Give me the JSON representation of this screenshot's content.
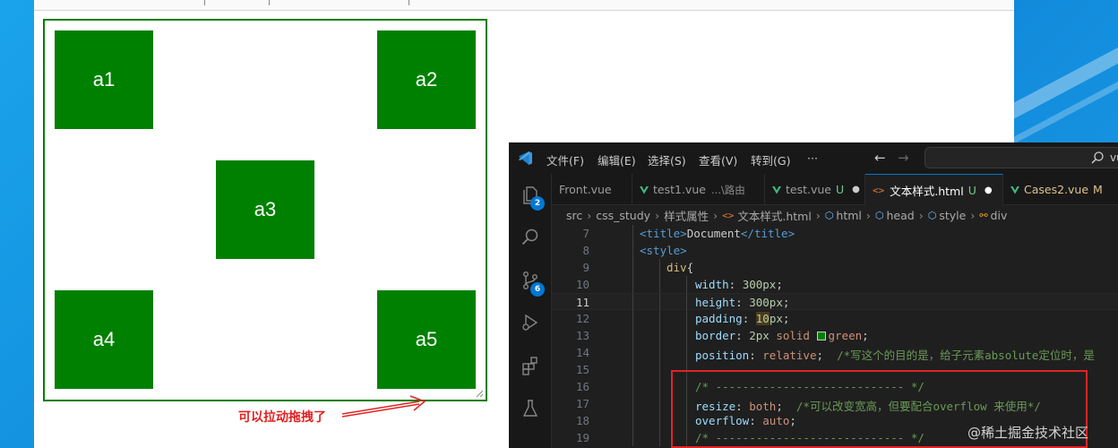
{
  "demo": {
    "boxes": [
      "a1",
      "a2",
      "a3",
      "a4",
      "a5"
    ],
    "annotation": "可以拉动拖拽了",
    "border_color": "#008000"
  },
  "vscode": {
    "menu": [
      "文件(F)",
      "编辑(E)",
      "选择(S)",
      "查看(V)",
      "转到(G)",
      "···"
    ],
    "search_text": "vu",
    "activity_badges": {
      "explorer": "2",
      "source_control": "6"
    },
    "tabs": [
      {
        "label": "Front.vue",
        "status": "",
        "desc": ""
      },
      {
        "label": "test1.vue",
        "status": "",
        "desc": "...\\路由"
      },
      {
        "label": "test.vue",
        "status": "U",
        "desc": ""
      },
      {
        "label": "文本样式.html",
        "status": "U",
        "desc": ""
      },
      {
        "label": "Cases2.vue",
        "status": "M",
        "desc": ""
      }
    ],
    "breadcrumb": [
      "src",
      "css_study",
      "样式属性",
      "文本样式.html",
      "html",
      "head",
      "style",
      "div"
    ],
    "lines": [
      "7",
      "8",
      "9",
      "10",
      "11",
      "12",
      "13",
      "14",
      "15",
      "16",
      "17",
      "18",
      "19"
    ],
    "code": {
      "l7_open": "<title>",
      "l7_text": "Document",
      "l7_close": "</title>",
      "l8": "<style>",
      "l9_sel": "div",
      "l9_brace": "{",
      "l10_prop": "width",
      "l10_val": "300px",
      "l11_prop": "height",
      "l11_val": "300px",
      "l12_prop": "padding",
      "l12_val_hl": "10",
      "l12_val": "px",
      "l13_prop": "border",
      "l13_num": "2px",
      "l13_val": "solid",
      "l13_color": "green",
      "l14_prop": "position",
      "l14_val": "relative",
      "l14_cmt": "/*写这个的目的是，给子元素absolute定位时，是",
      "l16_cmt": "/* ---------------------------- */",
      "l17_prop": "resize",
      "l17_val": "both",
      "l17_cmt": "/*可以改变宽高，但要配合overflow 来使用*/",
      "l18_prop": "overflow",
      "l18_val": "auto",
      "l19_cmt": "/* ---------------------------- */"
    }
  },
  "watermark": "@稀土掘金技术社区",
  "colors": {
    "accent": "#0078d4",
    "annotation_red": "#e02424",
    "box_green": "#008000"
  }
}
